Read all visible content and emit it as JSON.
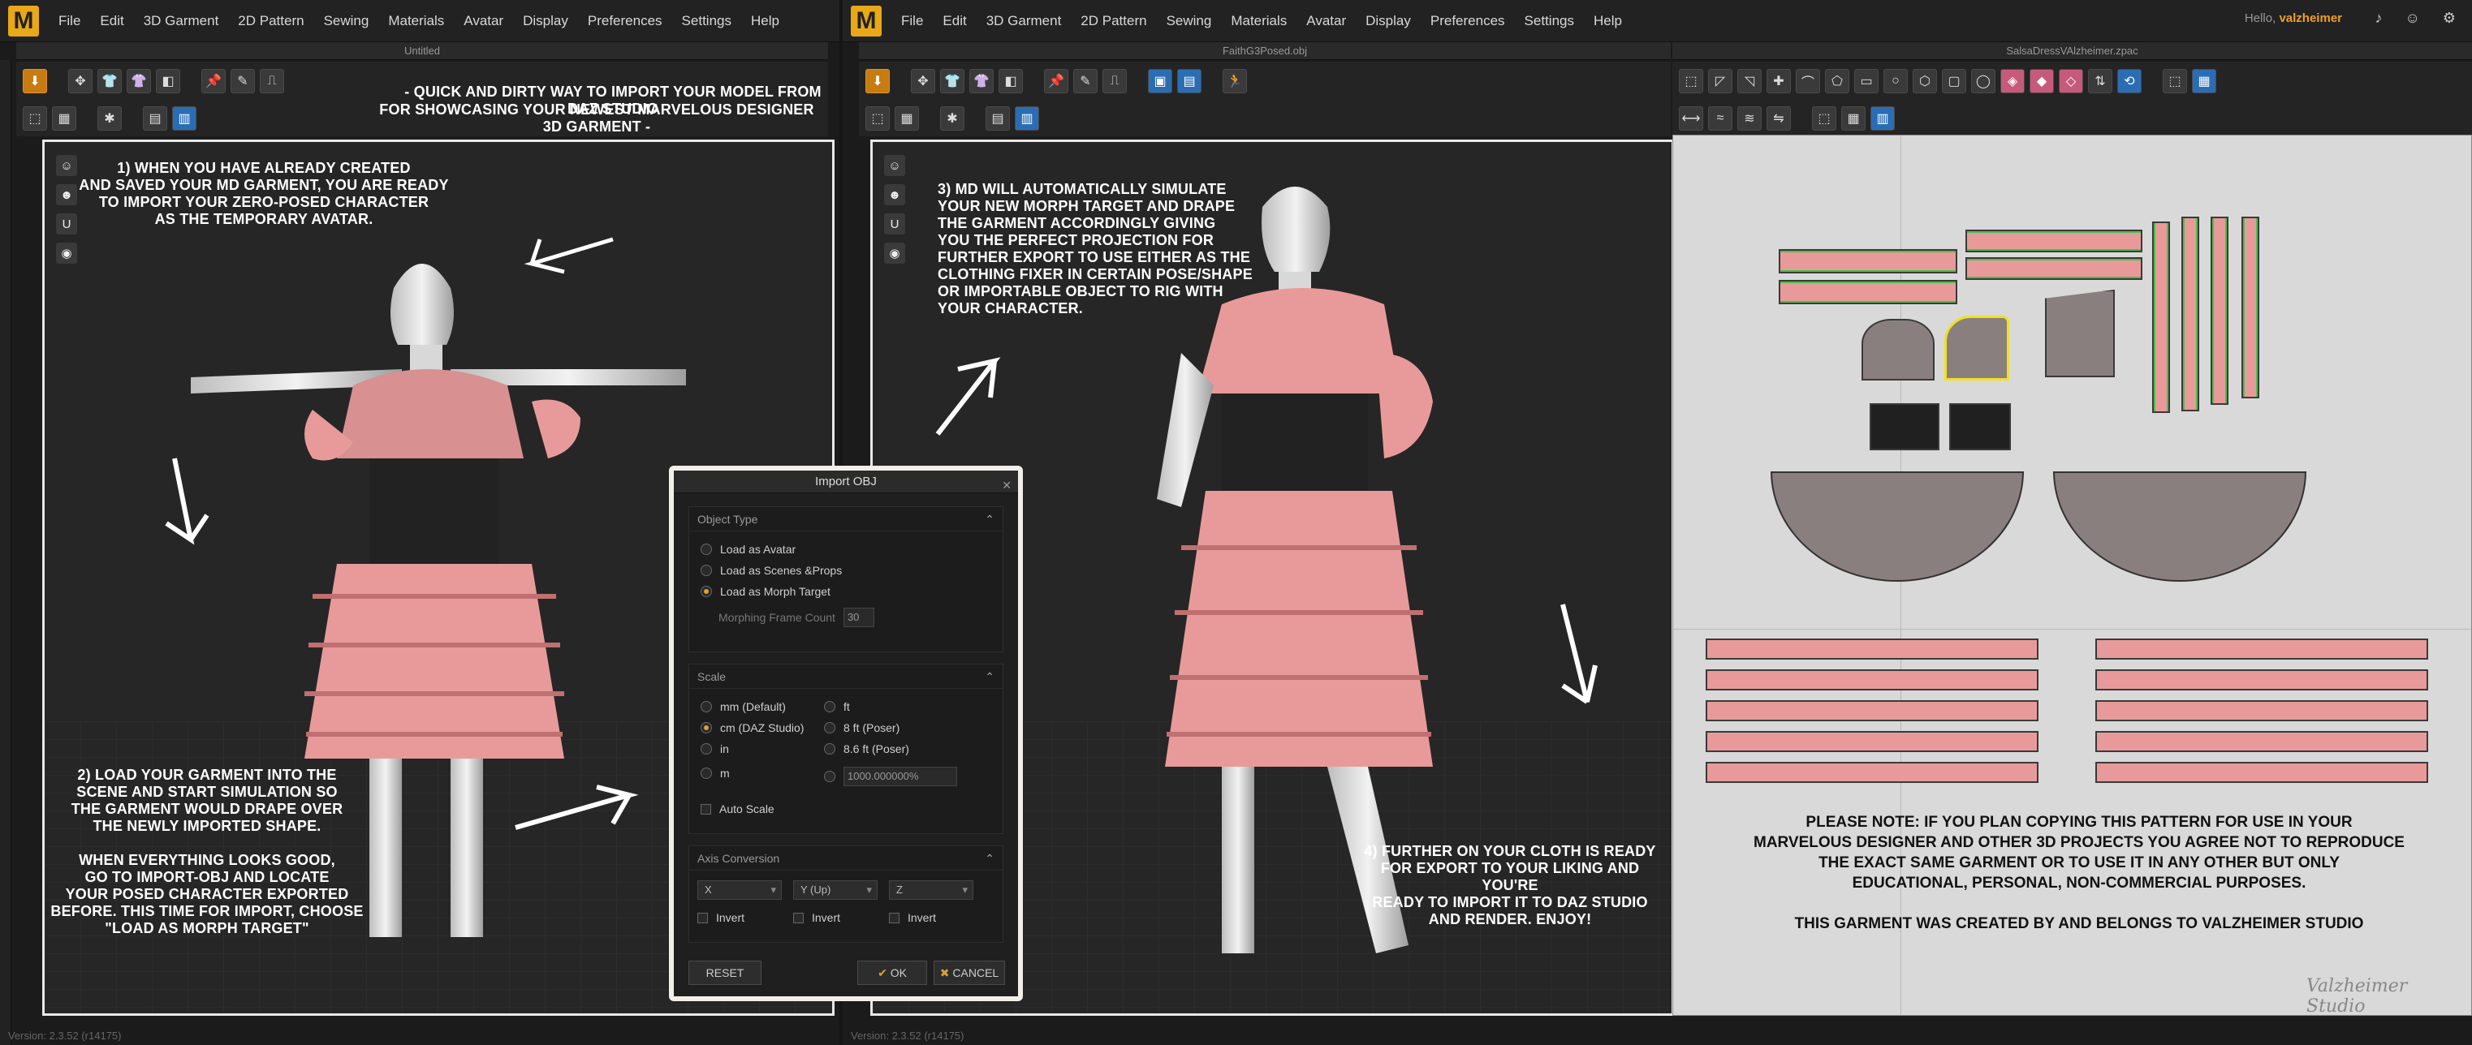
{
  "menu": [
    "File",
    "Edit",
    "3D Garment",
    "2D Pattern",
    "Sewing",
    "Materials",
    "Avatar",
    "Display",
    "Preferences",
    "Settings",
    "Help"
  ],
  "logo_letter": "M",
  "user": {
    "greeting": "Hello,",
    "name": "valzheimer"
  },
  "left_window": {
    "title": "Untitled",
    "status": "Version: 2.3.52   (r14175)"
  },
  "right_window": {
    "title_3d": "FaithG3Posed.obj",
    "title_2d": "SalsaDressVAlzheimer.zpac",
    "status": "Version: 2.3.52   (r14175)"
  },
  "annotations": {
    "headline_1": "- QUICK AND DIRTY WAY TO IMPORT YOUR MODEL FROM DAZ STUDIO",
    "headline_2": "FOR SHOWCASING YOUR NEWEST MARVELOUS DESIGNER 3D GARMENT -",
    "step1": [
      "1) WHEN YOU HAVE ALREADY CREATED",
      "AND SAVED YOUR MD GARMENT, YOU ARE READY",
      "TO IMPORT YOUR ZERO-POSED CHARACTER",
      "AS THE TEMPORARY AVATAR."
    ],
    "step2": [
      "2) LOAD YOUR GARMENT INTO THE",
      "SCENE AND START SIMULATION SO",
      "THE GARMENT WOULD DRAPE OVER",
      "THE NEWLY IMPORTED SHAPE.",
      "",
      "WHEN EVERYTHING LOOKS GOOD,",
      "GO TO IMPORT-OBJ AND LOCATE",
      "YOUR POSED CHARACTER EXPORTED",
      "BEFORE. THIS TIME FOR IMPORT, CHOOSE",
      "\"LOAD AS MORPH TARGET\""
    ],
    "step3": [
      "3) MD WILL AUTOMATICALLY SIMULATE",
      "YOUR NEW MORPH TARGET AND DRAPE",
      "THE GARMENT ACCORDINGLY GIVING",
      "YOU THE PERFECT PROJECTION FOR",
      "FURTHER EXPORT TO USE EITHER AS THE",
      "CLOTHING FIXER IN CERTAIN POSE/SHAPE",
      "OR IMPORTABLE OBJECT TO RIG WITH",
      "YOUR CHARACTER."
    ],
    "step4": [
      "4) FURTHER ON YOUR CLOTH IS READY",
      "FOR EXPORT TO YOUR LIKING AND YOU'RE",
      "READY TO IMPORT IT TO DAZ STUDIO",
      "AND RENDER. ENJOY!"
    ],
    "pattern_note": [
      "PLEASE NOTE: IF YOU PLAN COPYING THIS PATTERN  FOR USE IN YOUR",
      "MARVELOUS DESIGNER AND OTHER 3D PROJECTS YOU AGREE NOT TO REPRODUCE",
      "THE EXACT SAME GARMENT OR TO USE IT IN ANY OTHER BUT ONLY",
      "EDUCATIONAL, PERSONAL, NON-COMMERCIAL PURPOSES.",
      "",
      "THIS GARMENT WAS CREATED BY AND BELONGS TO VALZHEIMER STUDIO"
    ],
    "watermark": "Valzheimer Studio"
  },
  "dialog": {
    "title": "Import OBJ",
    "object_type": {
      "header": "Object Type",
      "options": [
        "Load as Avatar",
        "Load as Scenes &Props",
        "Load as Morph Target"
      ],
      "selected": 2,
      "morph_label": "Morphing Frame Count",
      "morph_value": "30"
    },
    "scale": {
      "header": "Scale",
      "left": [
        "mm (Default)",
        "cm (DAZ Studio)",
        "in",
        "m"
      ],
      "right": [
        "ft",
        "8 ft (Poser)",
        "8.6 ft (Poser)",
        ""
      ],
      "selected": "cm (DAZ Studio)",
      "custom_value": "1000.000000%",
      "auto_scale": "Auto Scale"
    },
    "axis": {
      "header": "Axis Conversion",
      "selects": [
        "X",
        "Y (Up)",
        "Z"
      ],
      "invert": "Invert"
    },
    "buttons": {
      "reset": "RESET",
      "ok": "OK",
      "cancel": "CANCEL"
    }
  },
  "colors": {
    "accent": "#e8a818",
    "fabric": "#e89a9a",
    "stitch": "#4ac04a",
    "canvas3d": "#262626",
    "canvas2d": "#d9d9d9"
  }
}
